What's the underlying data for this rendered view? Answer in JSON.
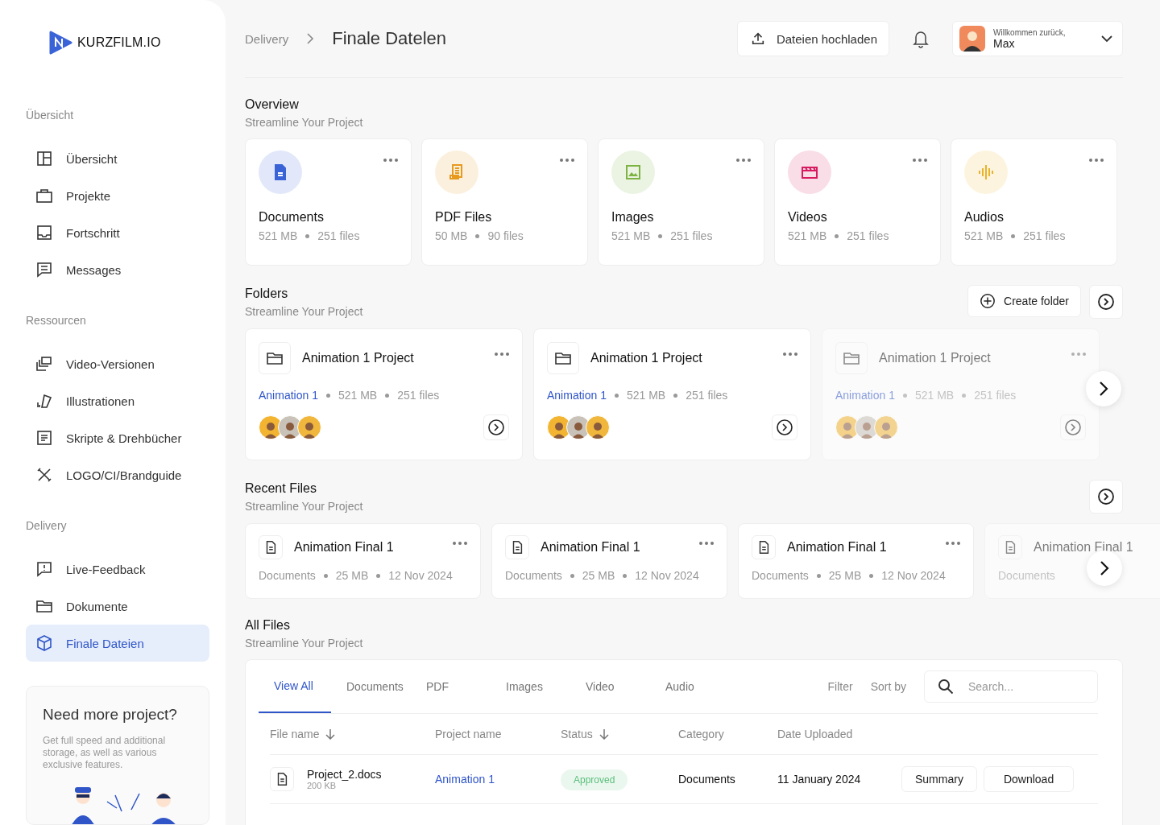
{
  "sidebar": {
    "logo": "KURZFILM.IO",
    "sections": [
      {
        "label": "Übersicht",
        "items": [
          {
            "label": "Übersicht",
            "kind": "layout",
            "selected": false
          },
          {
            "label": "Projekte",
            "kind": "briefcase",
            "selected": false
          },
          {
            "label": "Fortschritt",
            "kind": "inbox",
            "selected": false
          },
          {
            "label": "Messages",
            "kind": "message",
            "selected": false
          }
        ]
      },
      {
        "label": "Ressourcen",
        "items": [
          {
            "label": "Video-Versionen",
            "kind": "versions",
            "selected": false
          },
          {
            "label": "Illustrationen",
            "kind": "brush",
            "selected": false
          },
          {
            "label": "Skripte & Drehbücher",
            "kind": "script",
            "selected": false
          },
          {
            "label": "LOGO/CI/Brandguide",
            "kind": "tools",
            "selected": false
          }
        ]
      },
      {
        "label": "Delivery",
        "items": [
          {
            "label": "Live-Feedback",
            "kind": "feedback",
            "selected": false
          },
          {
            "label": "Dokumente",
            "kind": "folder",
            "selected": false
          },
          {
            "label": "Finale Dateien",
            "kind": "box",
            "selected": true
          }
        ]
      }
    ],
    "promo": {
      "title": "Need more project?",
      "text": "Get full speed and additional storage, as well as various exclusive features."
    }
  },
  "header": {
    "breadcrumb": "Delivery",
    "title": "Finale Datelen",
    "upload": "Dateien hochladen",
    "greeting": "Willkommen zurück,",
    "user": "Max"
  },
  "overview": {
    "title": "Overview",
    "subtitle": "Streamline Your Project",
    "cards": [
      {
        "kind": "documents",
        "title": "Documents",
        "size": "521 MB",
        "count": "251 files",
        "color": "#3b63d8"
      },
      {
        "kind": "pdf",
        "title": "PDF Files",
        "size": "50 MB",
        "count": "90 files",
        "color": "#e79a1e"
      },
      {
        "kind": "images",
        "title": "Images",
        "size": "521 MB",
        "count": "251 files",
        "color": "#7cb342"
      },
      {
        "kind": "videos",
        "title": "Videos",
        "size": "521 MB",
        "count": "251 files",
        "color": "#d81b60"
      },
      {
        "kind": "audios",
        "title": "Audios",
        "size": "521 MB",
        "count": "251 files",
        "color": "#e9b32a"
      }
    ]
  },
  "folders": {
    "title": "Folders",
    "subtitle": "Streamline Your Project",
    "button": "Create folder",
    "items": [
      {
        "name": "Animation 1 Project",
        "project": "Animation 1",
        "size": "521 MB",
        "files": "251 files",
        "faded": false
      },
      {
        "name": "Animation 1 Project",
        "project": "Animation 1",
        "size": "521 MB",
        "files": "251 files",
        "faded": false
      },
      {
        "name": "Animation 1 Project",
        "project": "Animation 1",
        "size": "521 MB",
        "files": "251 files",
        "faded": true
      }
    ]
  },
  "recent": {
    "title": "Recent Files",
    "subtitle": "Streamline Your Project",
    "items": [
      {
        "name": "Animation Final 1",
        "category": "Documents",
        "size": "25 MB",
        "date": "12 Nov 2024",
        "faded": false
      },
      {
        "name": "Animation Final 1",
        "category": "Documents",
        "size": "25 MB",
        "date": "12 Nov 2024",
        "faded": false
      },
      {
        "name": "Animation Final 1",
        "category": "Documents",
        "size": "25 MB",
        "date": "12 Nov 2024",
        "faded": false
      },
      {
        "name": "Animation Final 1",
        "category": "Documents",
        "faded": true
      }
    ]
  },
  "files": {
    "title": "All Files",
    "subtitle": "Streamline Your Project",
    "tabs": [
      {
        "label": "View All",
        "selected": true
      },
      {
        "label": "Documents",
        "selected": false
      },
      {
        "label": "PDF",
        "selected": false
      },
      {
        "label": "Images",
        "selected": false
      },
      {
        "label": "Video",
        "selected": false
      },
      {
        "label": "Audio",
        "selected": false
      }
    ],
    "filter": "Filter",
    "sort": "Sort by",
    "search": {
      "placeholder": "Search..."
    },
    "columns": [
      {
        "label": "File name",
        "sortable": true
      },
      {
        "label": "Project name",
        "sortable": false
      },
      {
        "label": "Status",
        "sortable": true
      },
      {
        "label": "Category",
        "sortable": false
      },
      {
        "label": "Date Uploaded",
        "sortable": false
      }
    ],
    "rows": [
      {
        "name": "Project_2.docs",
        "size": "200 KB",
        "project": "Animation 1",
        "status": "Approved",
        "category": "Documents",
        "date": "11 January 2024",
        "actions": [
          "Summary",
          "Download"
        ]
      }
    ]
  }
}
